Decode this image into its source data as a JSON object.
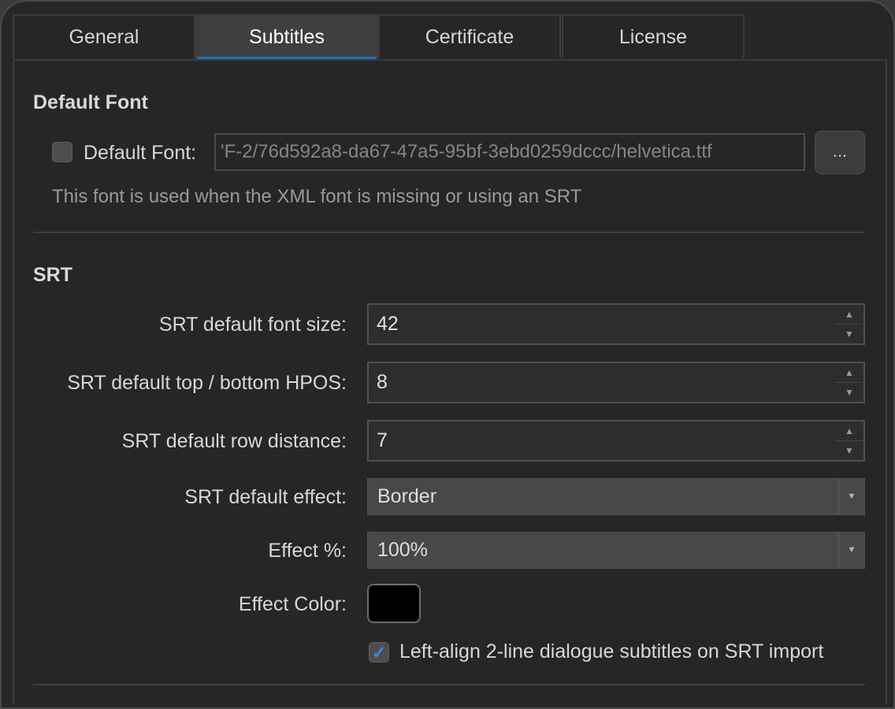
{
  "tabs": [
    {
      "label": "General",
      "active": false
    },
    {
      "label": "Subtitles",
      "active": true
    },
    {
      "label": "Certificate",
      "active": false
    },
    {
      "label": "License",
      "active": false
    }
  ],
  "default_font": {
    "section_title": "Default Font",
    "checkbox_label": "Default Font:",
    "checked": false,
    "path_value": "'F-2/76d592a8-da67-47a5-95bf-3ebd0259dccc/helvetica.ttf",
    "browse_label": "...",
    "hint": "This font is used when the XML font is missing or using an SRT"
  },
  "srt": {
    "section_title": "SRT",
    "font_size_label": "SRT default font size:",
    "font_size_value": "42",
    "hpos_label": "SRT default top / bottom HPOS:",
    "hpos_value": "8",
    "row_distance_label": "SRT default row distance:",
    "row_distance_value": "7",
    "effect_label": "SRT default effect:",
    "effect_value": "Border",
    "effect_percent_label": "Effect %:",
    "effect_percent_value": "100%",
    "effect_color_label": "Effect Color:",
    "effect_color": "#000000",
    "left_align_label": "Left-align 2-line dialogue subtitles on SRT import",
    "left_align_checked": true
  },
  "colors": {
    "accent": "#1f6fbf",
    "background": "#262627"
  }
}
